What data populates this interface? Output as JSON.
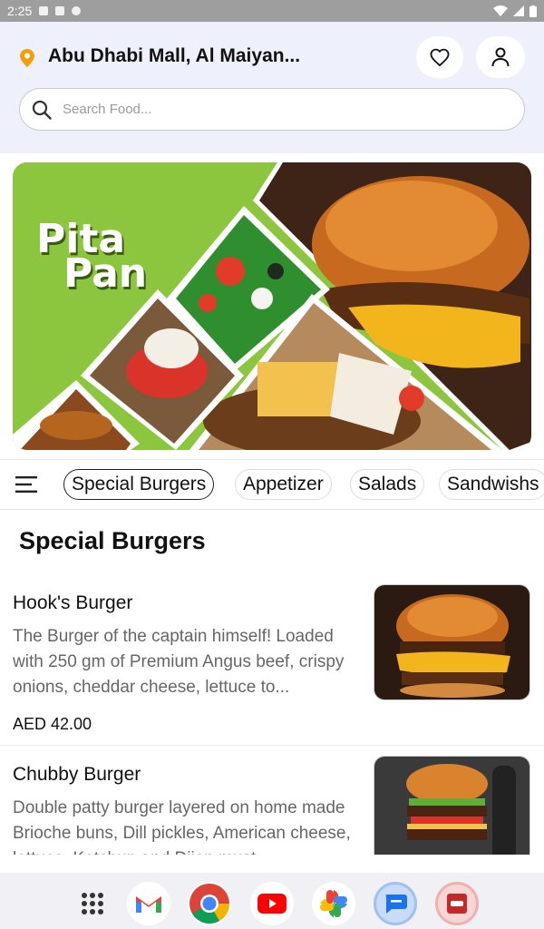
{
  "status_bar": {
    "time": "2:25"
  },
  "header": {
    "location": "Abu Dhabi Mall, Al Maiyan...",
    "search_placeholder": "Search Food..."
  },
  "banner": {
    "title_line1": "Pita",
    "title_line2": "Pan"
  },
  "categories": [
    "Special Burgers",
    "Appetizer",
    "Salads",
    "Sandwishs"
  ],
  "section_title": "Special Burgers",
  "items": [
    {
      "name": "Hook's Burger",
      "description": "The Burger of the captain himself! Loaded with 250 gm of Premium Angus beef, crispy onions, cheddar cheese, lettuce to...",
      "price": "AED 42.00"
    },
    {
      "name": "Chubby Burger",
      "description": "Double patty burger layered on home made Brioche buns, Dill pickles, American cheese, lettuce, Ketchup and Dijon must..."
    }
  ],
  "dock": [
    "apps-grid-icon",
    "gmail-icon",
    "chrome-icon",
    "youtube-icon",
    "photos-icon",
    "messages-icon",
    "pita-pan-app-icon"
  ],
  "colors": {
    "header_bg": "#eef0fb",
    "banner_green": "#8cc63f",
    "pin": "#f59e0b"
  }
}
